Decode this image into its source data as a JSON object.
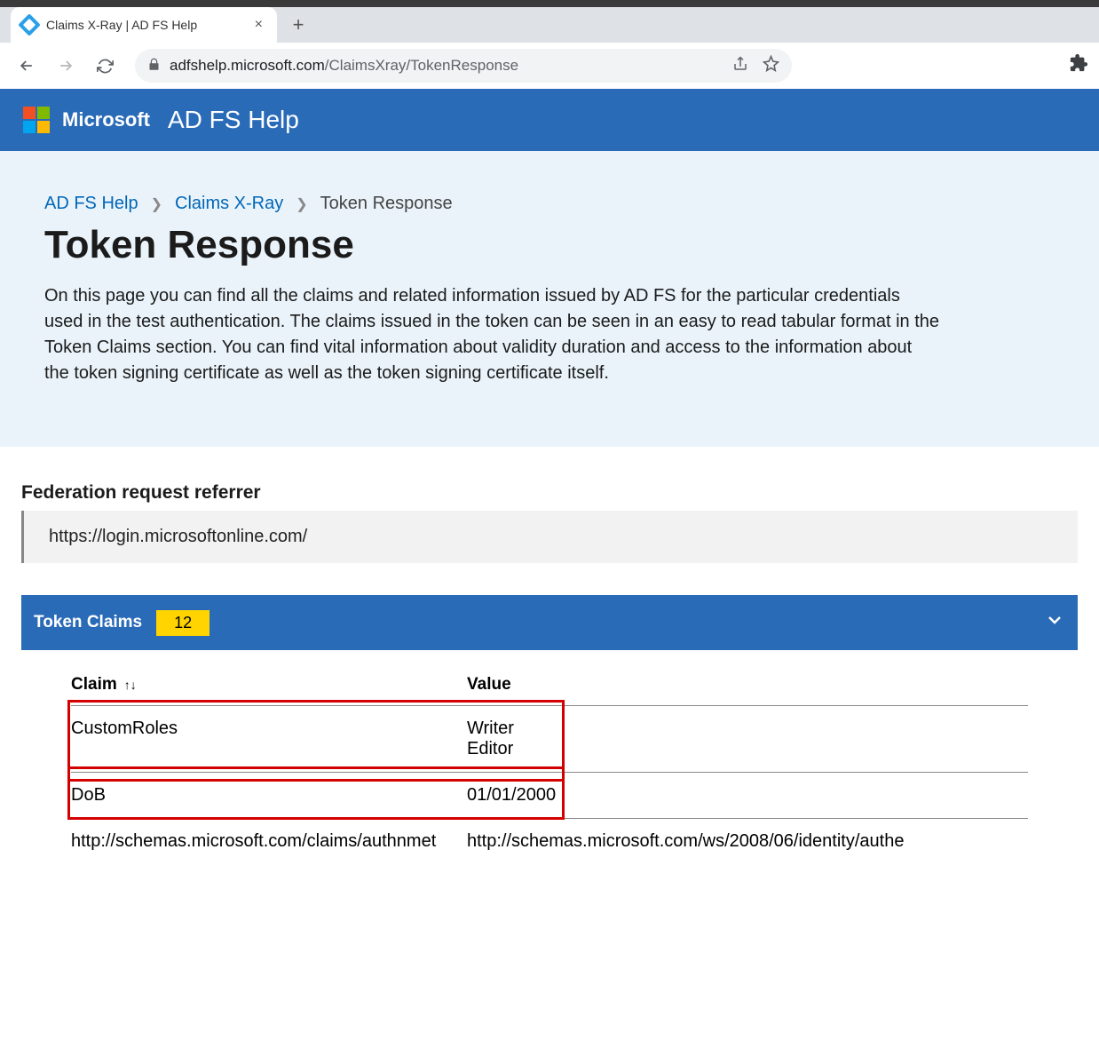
{
  "browser": {
    "tab_title": "Claims X-Ray | AD FS Help",
    "url_domain": "adfshelp.microsoft.com",
    "url_path": "/ClaimsXray/TokenResponse"
  },
  "header": {
    "brand": "Microsoft",
    "app_name": "AD FS Help"
  },
  "breadcrumb": {
    "items": [
      {
        "label": "AD FS Help",
        "link": true
      },
      {
        "label": "Claims X-Ray",
        "link": true
      },
      {
        "label": "Token Response",
        "link": false
      }
    ]
  },
  "page": {
    "title": "Token Response",
    "description": "On this page you can find all the claims and related information issued by AD FS for the particular credentials used in the test authentication. The claims issued in the token can be seen in an easy to read tabular format in the Token Claims section. You can find vital information about validity duration and access to the information about the token signing certificate as well as the token signing certificate itself."
  },
  "referrer": {
    "label": "Federation request referrer",
    "value": "https://login.microsoftonline.com/"
  },
  "claims": {
    "panel_title": "Token Claims",
    "count": "12",
    "columns": {
      "claim": "Claim",
      "value": "Value"
    },
    "rows": [
      {
        "claim": "CustomRoles",
        "value": "Writer\nEditor",
        "highlight": true
      },
      {
        "claim": "DoB",
        "value": "01/01/2000",
        "highlight": true
      },
      {
        "claim": "http://schemas.microsoft.com/claims/authnmet",
        "value": "http://schemas.microsoft.com/ws/2008/06/identity/authe",
        "highlight": false
      }
    ]
  }
}
